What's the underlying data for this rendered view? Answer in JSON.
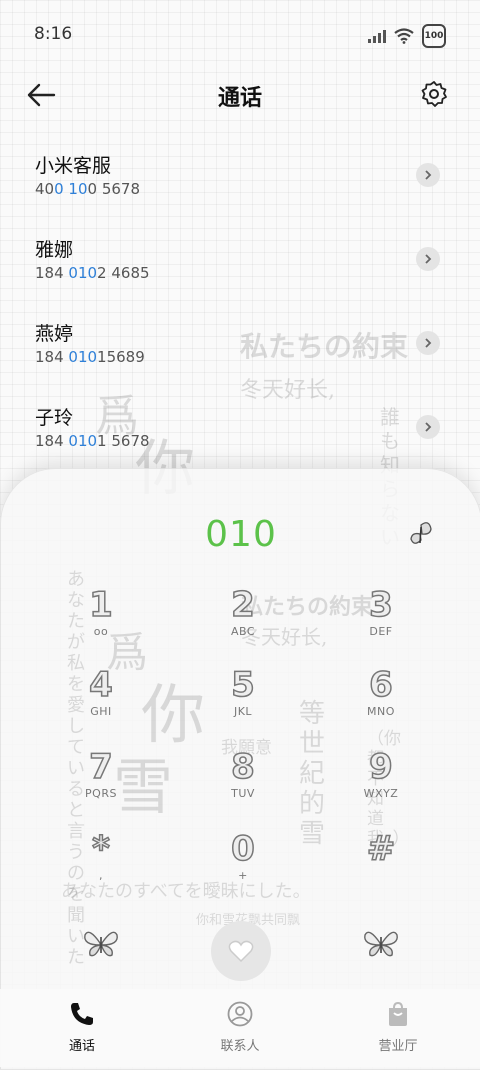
{
  "status_bar": {
    "time": "8:16",
    "battery": "100"
  },
  "header": {
    "title": "通话"
  },
  "contacts": [
    {
      "name": "小米客服",
      "number_parts": [
        "40",
        "0",
        " ",
        "10",
        "0 5678"
      ]
    },
    {
      "name": "雅娜",
      "number_parts": [
        "184 ",
        "010",
        "2 4685"
      ]
    },
    {
      "name": "燕婷",
      "number_parts": [
        "184 ",
        "010",
        "15689"
      ]
    },
    {
      "name": "子玲",
      "number_parts": [
        "184 ",
        "010",
        "1 5678"
      ]
    }
  ],
  "dialer": {
    "input": "010"
  },
  "keypad": [
    {
      "digit": "1",
      "letters": "oo"
    },
    {
      "digit": "2",
      "letters": "ABC"
    },
    {
      "digit": "3",
      "letters": "DEF"
    },
    {
      "digit": "4",
      "letters": "GHI"
    },
    {
      "digit": "5",
      "letters": "JKL"
    },
    {
      "digit": "6",
      "letters": "MNO"
    },
    {
      "digit": "7",
      "letters": "PQRS"
    },
    {
      "digit": "8",
      "letters": "TUV"
    },
    {
      "digit": "9",
      "letters": "WXYZ"
    },
    {
      "digit": "*",
      "letters": ","
    },
    {
      "digit": "0",
      "letters": "+"
    },
    {
      "digit": "#",
      "letters": ""
    }
  ],
  "bottom_nav": [
    {
      "label": "通话",
      "icon": "phone-icon",
      "active": true
    },
    {
      "label": "联系人",
      "icon": "contacts-icon",
      "active": false
    },
    {
      "label": "营业厅",
      "icon": "shop-bag-icon",
      "active": false
    }
  ],
  "wallpaper_text": {
    "promise": "私たちの約束",
    "winter": "冬天好长,",
    "wei": "爲",
    "ni": "你",
    "xue": "雪",
    "wish": "我願意",
    "era": "等世紀的雪",
    "vertical": "あなたが私を愛していると言うのを聞いた",
    "ambiguous": "あなたのすべてを曖昧にした。",
    "who": "誰も知らない",
    "fall": "你和雪花飘共同飘",
    "paren": "（你都不知道我。）"
  },
  "colors": {
    "accent_green": "#5cc24a",
    "highlight_blue": "#2f80d8"
  }
}
